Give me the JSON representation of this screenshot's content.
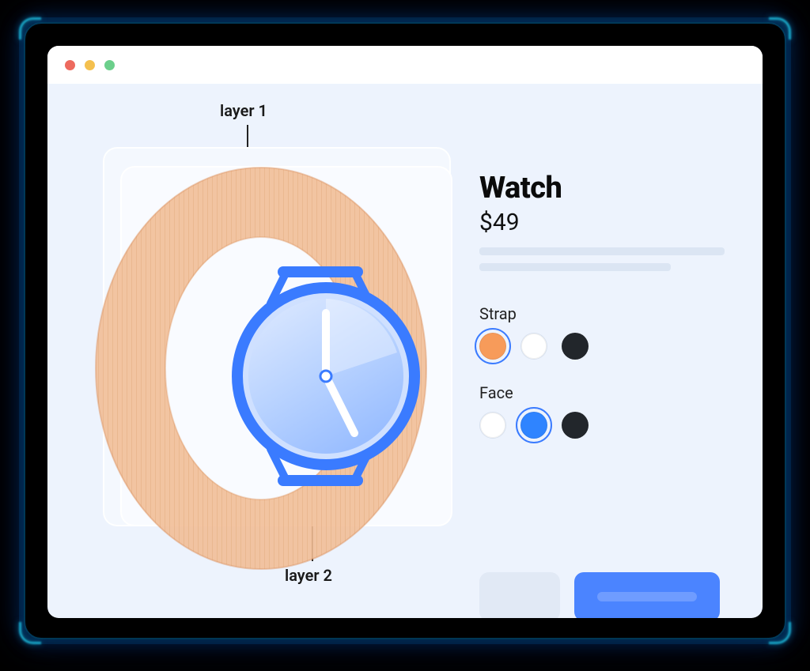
{
  "annotations": {
    "layer1": "layer 1",
    "layer2": "layer 2"
  },
  "product": {
    "title": "Watch",
    "price": "$49"
  },
  "options": {
    "strap": {
      "label": "Strap",
      "selected": "orange",
      "choices": [
        "orange",
        "white",
        "black"
      ]
    },
    "face": {
      "label": "Face",
      "selected": "blue",
      "choices": [
        "white",
        "blue",
        "black"
      ]
    }
  },
  "colors": {
    "accent": "#3a7bff",
    "orange": "#f79b5a",
    "white": "#ffffff",
    "black": "#22262b",
    "blue": "#2f84ff"
  },
  "icons": {
    "close": "close-icon",
    "minimize": "minimize-icon",
    "maximize": "maximize-icon"
  }
}
